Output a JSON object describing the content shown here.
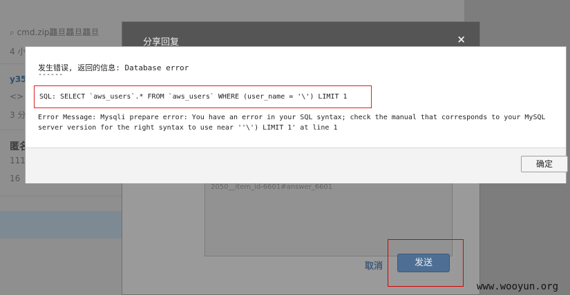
{
  "background_page": {
    "attachment": "cmd.zip龘旦龘旦龘旦",
    "time_1": "4 小",
    "user_1": "y35",
    "snippet_1": "<>",
    "time_2": "3 分",
    "anon": "匿名",
    "number": "111",
    "time_3": "16"
  },
  "share_dialog": {
    "title": "分享回复",
    "close_glyph": "×",
    "textarea_text": "2050__item_id-6601#answer_6601",
    "cancel_label": "取消",
    "send_label": "发送"
  },
  "error_modal": {
    "title": "发生错误, 返回的信息: Database error",
    "divider": "------",
    "sql_line": "SQL: SELECT `aws_users`.* FROM `aws_users` WHERE (user_name = '\\') LIMIT 1",
    "message_line1": "Error Message: Mysqli prepare error: You have an error in your SQL syntax; check the manual that corresponds to your MySQL",
    "message_line2": "server version for the right syntax to use near ''\\') LIMIT 1' at line 1",
    "ok_label": "确定"
  },
  "watermark": "www.wooyun.org"
}
